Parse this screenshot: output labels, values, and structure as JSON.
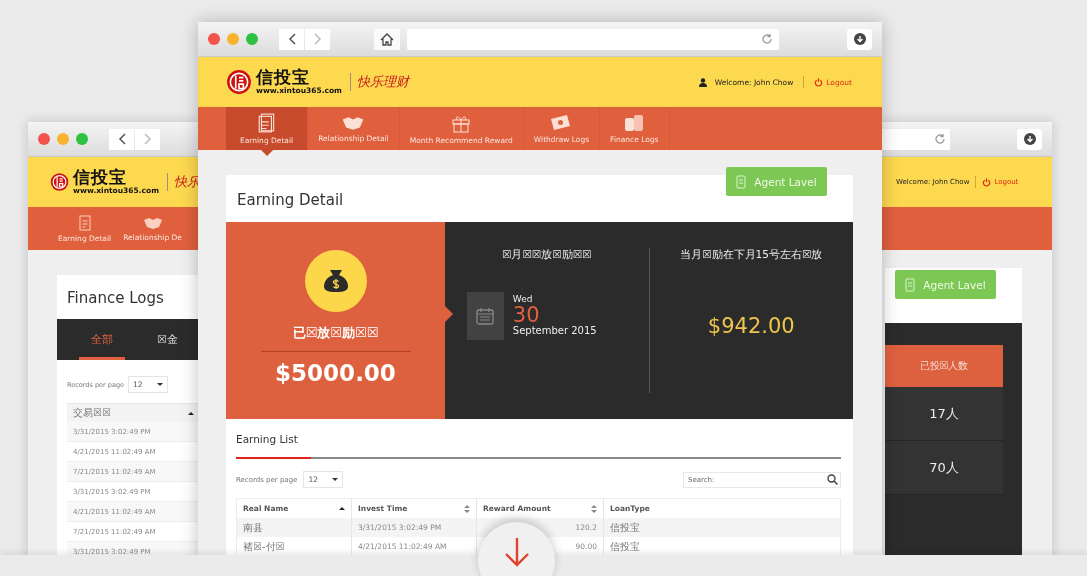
{
  "left_window": {
    "logo": {
      "name": "信投宝",
      "url": "www.xintou365.com",
      "slogan": "快乐"
    },
    "nav": [
      {
        "label": "Earning Detail",
        "kind": "bill"
      },
      {
        "label": "Relationship De",
        "kind": "handshake"
      }
    ],
    "title": "Finance Logs",
    "tabs": [
      {
        "label": "全部",
        "selected": true
      },
      {
        "label": "☒金",
        "selected": false
      }
    ],
    "records_label": "Records per page",
    "records_value": "12",
    "table": {
      "columns": [
        {
          "label": "交易☒☒",
          "kind": "sorted"
        }
      ],
      "rows": [
        "3/31/2015 3:02:49 PM",
        "4/21/2015 11:02:49 AM",
        "7/21/2015 11:02:49 AM",
        "3/31/2015 3:02:49 PM",
        "4/21/2015 11:02:49 AM",
        "7/21/2015 11:02:49 AM",
        "3/31/2015 3:02:49 PM"
      ]
    }
  },
  "right_window": {
    "welcome": "Welcome: John Chow",
    "logout": "Logout",
    "agent_button": "Agent Lavel",
    "table": {
      "header": "已投☒人数",
      "rows": [
        "17人",
        "70人"
      ]
    }
  },
  "main_window": {
    "logo": {
      "name": "信投宝",
      "url": "www.xintou365.com",
      "slogan": "快乐理财"
    },
    "welcome": "Welcome: John Chow",
    "logout": "Logout",
    "nav": [
      {
        "label": "Earning Detail",
        "kind": "bill",
        "selected": true
      },
      {
        "label": "Relationship Detail",
        "kind": "handshake",
        "selected": false
      },
      {
        "label": "Month Recommend Reward",
        "kind": "gift",
        "selected": false
      },
      {
        "label": "Withdraw Logs",
        "kind": "money",
        "selected": false
      },
      {
        "label": "Finance Logs",
        "kind": "coins",
        "selected": false
      }
    ],
    "title": "Earning Detail",
    "agent_button": "Agent Lavel",
    "paid": {
      "label": "已☒放☒励☒☒",
      "amount": "$5000.00"
    },
    "month": {
      "label": "☒月☒☒放☒励☒☒",
      "weekday": "Wed",
      "day": "30",
      "month_year": "September 2015"
    },
    "next": {
      "label": "当月☒励在下月15号左右☒放",
      "amount": "$942.00"
    },
    "list_title": "Earning List",
    "records_label": "Records per page",
    "records_value": "12",
    "search_placeholder": "Search:",
    "table": {
      "columns": [
        {
          "label": "Real Name",
          "kind": "sorted"
        },
        {
          "label": "Invest Time",
          "kind": "sortable"
        },
        {
          "label": "Reward Amount",
          "kind": "sortable"
        },
        {
          "label": "LoanType",
          "kind": "plain"
        }
      ],
      "rows": [
        [
          "南县",
          "3/31/2015 3:02:49 PM",
          "120.2",
          "信投宝"
        ],
        [
          "褚☒-付☒",
          "4/21/2015 11:02:49 AM",
          "90.00",
          "信投宝"
        ]
      ]
    }
  }
}
